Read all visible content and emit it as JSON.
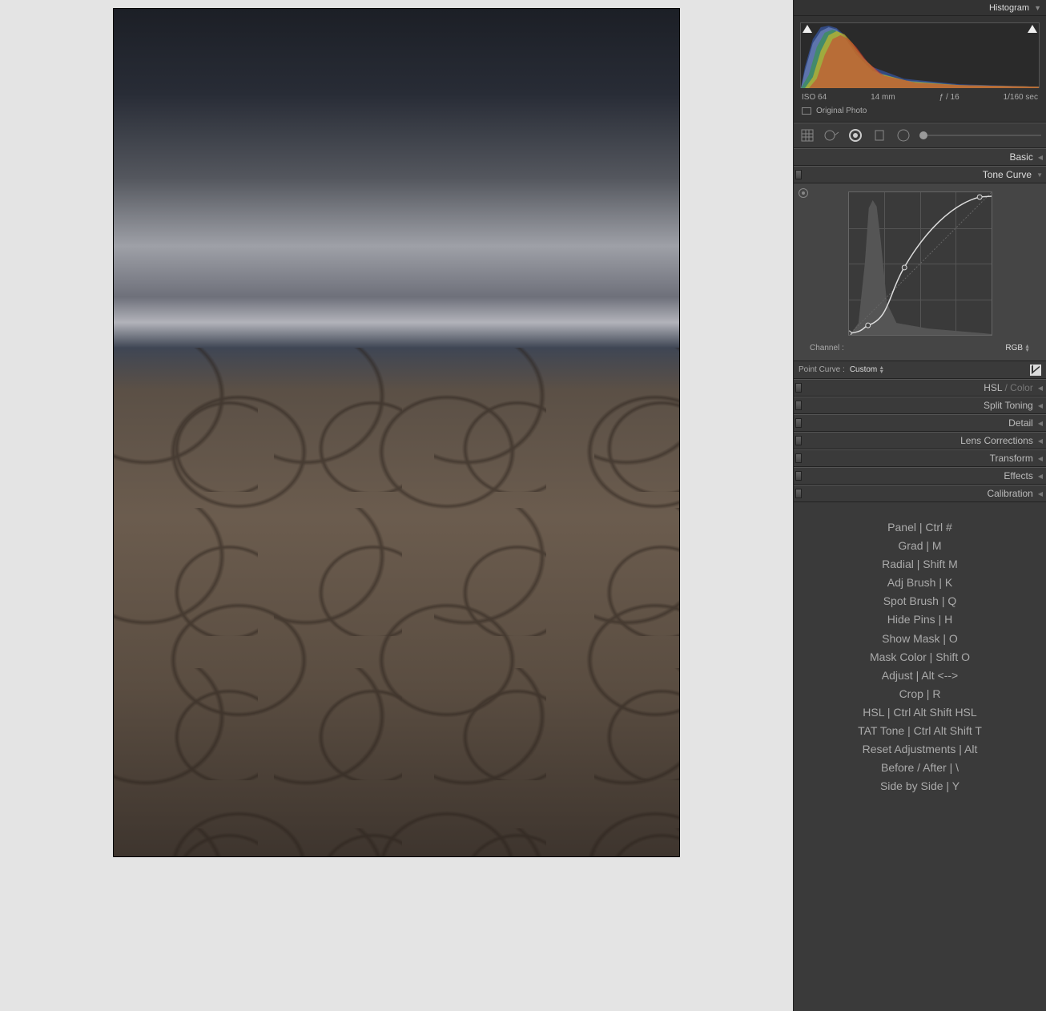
{
  "histogram": {
    "title": "Histogram",
    "iso": "ISO 64",
    "focal": "14 mm",
    "aperture": "ƒ / 16",
    "shutter": "1/160 sec",
    "original": "Original Photo"
  },
  "panels": {
    "basic": "Basic",
    "tone_curve": "Tone Curve",
    "hsl": "HSL",
    "hsl_sep": " / ",
    "hsl_color": "Color",
    "split_toning": "Split Toning",
    "detail": "Detail",
    "lens": "Lens Corrections",
    "transform": "Transform",
    "effects": "Effects",
    "calibration": "Calibration"
  },
  "tone_curve": {
    "channel_label": "Channel :",
    "channel_value": "RGB",
    "point_label": "Point Curve :",
    "point_value": "Custom"
  },
  "shortcuts": [
    "Panel | Ctrl #",
    "Grad | M",
    "Radial | Shift M",
    "Adj Brush | K",
    "Spot Brush | Q",
    "Hide Pins | H",
    "Show Mask | O",
    "Mask Color | Shift O",
    "Adjust | Alt <-->",
    "Crop | R",
    "HSL | Ctrl Alt Shift HSL",
    "TAT Tone | Ctrl Alt Shift T",
    "Reset Adjustments | Alt",
    "Before / After | \\",
    "Side by Side | Y"
  ]
}
